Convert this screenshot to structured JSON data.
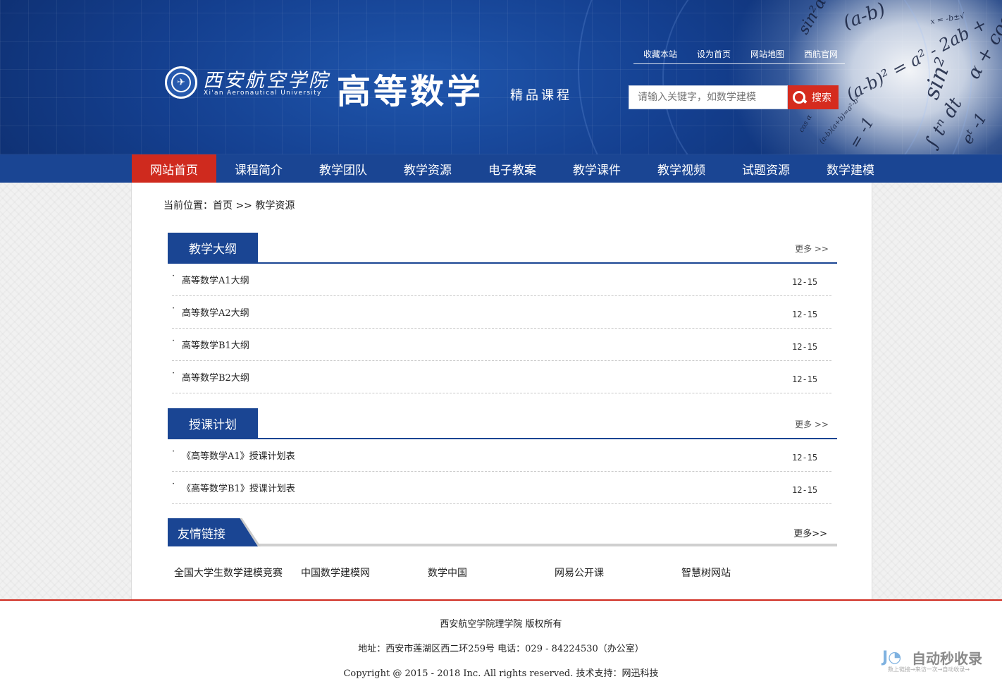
{
  "header": {
    "university_cn": "西安航空学院",
    "university_en": "Xi'an Aeronautical University",
    "site_title": "高等数学",
    "site_subtitle": "精品课程",
    "top_links": [
      "收藏本站",
      "设为首页",
      "网站地图",
      "西航官网"
    ],
    "search_placeholder": "请输入关键字，如数学建模",
    "search_button": "搜索",
    "math_formulas": [
      "(a-b)",
      "sin²α",
      "(a-b)² = a² - 2ab +",
      "sin²",
      "α + cos",
      "= -1",
      "∫ tⁿ dt",
      "eᵗ -1",
      "cos α",
      "(a-b)(a+b)=a²-b²",
      "x = -b±√"
    ]
  },
  "nav": {
    "items": [
      "网站首页",
      "课程简介",
      "教学团队",
      "教学资源",
      "电子教案",
      "教学课件",
      "教学视频",
      "试题资源",
      "数学建模"
    ],
    "active_index": 0
  },
  "breadcrumb": "当前位置：首页 >> 教学资源",
  "sections": [
    {
      "title": "教学大纲",
      "more": "更多 >>",
      "items": [
        {
          "title": "高等数学A1大纲",
          "date": "12-15"
        },
        {
          "title": "高等数学A2大纲",
          "date": "12-15"
        },
        {
          "title": "高等数学B1大纲",
          "date": "12-15"
        },
        {
          "title": "高等数学B2大纲",
          "date": "12-15"
        }
      ]
    },
    {
      "title": "授课计划",
      "more": "更多 >>",
      "items": [
        {
          "title": "《高等数学A1》授课计划表",
          "date": "12-15"
        },
        {
          "title": "《高等数学B1》授课计划表",
          "date": "12-15"
        }
      ]
    }
  ],
  "friend_links": {
    "title": "友情链接",
    "more": "更多>>",
    "items": [
      "全国大学生数学建模竞赛",
      "中国数学建模网",
      "数学中国",
      "网易公开课",
      "智慧树网站"
    ]
  },
  "footer": {
    "line1": "西安航空学院理学院 版权所有",
    "line2": "地址：西安市莲湖区西二环259号 电话：029 - 84224530（办公室）",
    "line3": "Copyright @ 2015 - 2018 Inc. All rights reserved. 技术支持：网迅科技"
  },
  "watermark": {
    "text": "自动秒收录",
    "sub": "数上链接→来访一次→自动收录→"
  },
  "colors": {
    "primary_blue": "#1a4593",
    "accent_red": "#cf2a1e"
  }
}
